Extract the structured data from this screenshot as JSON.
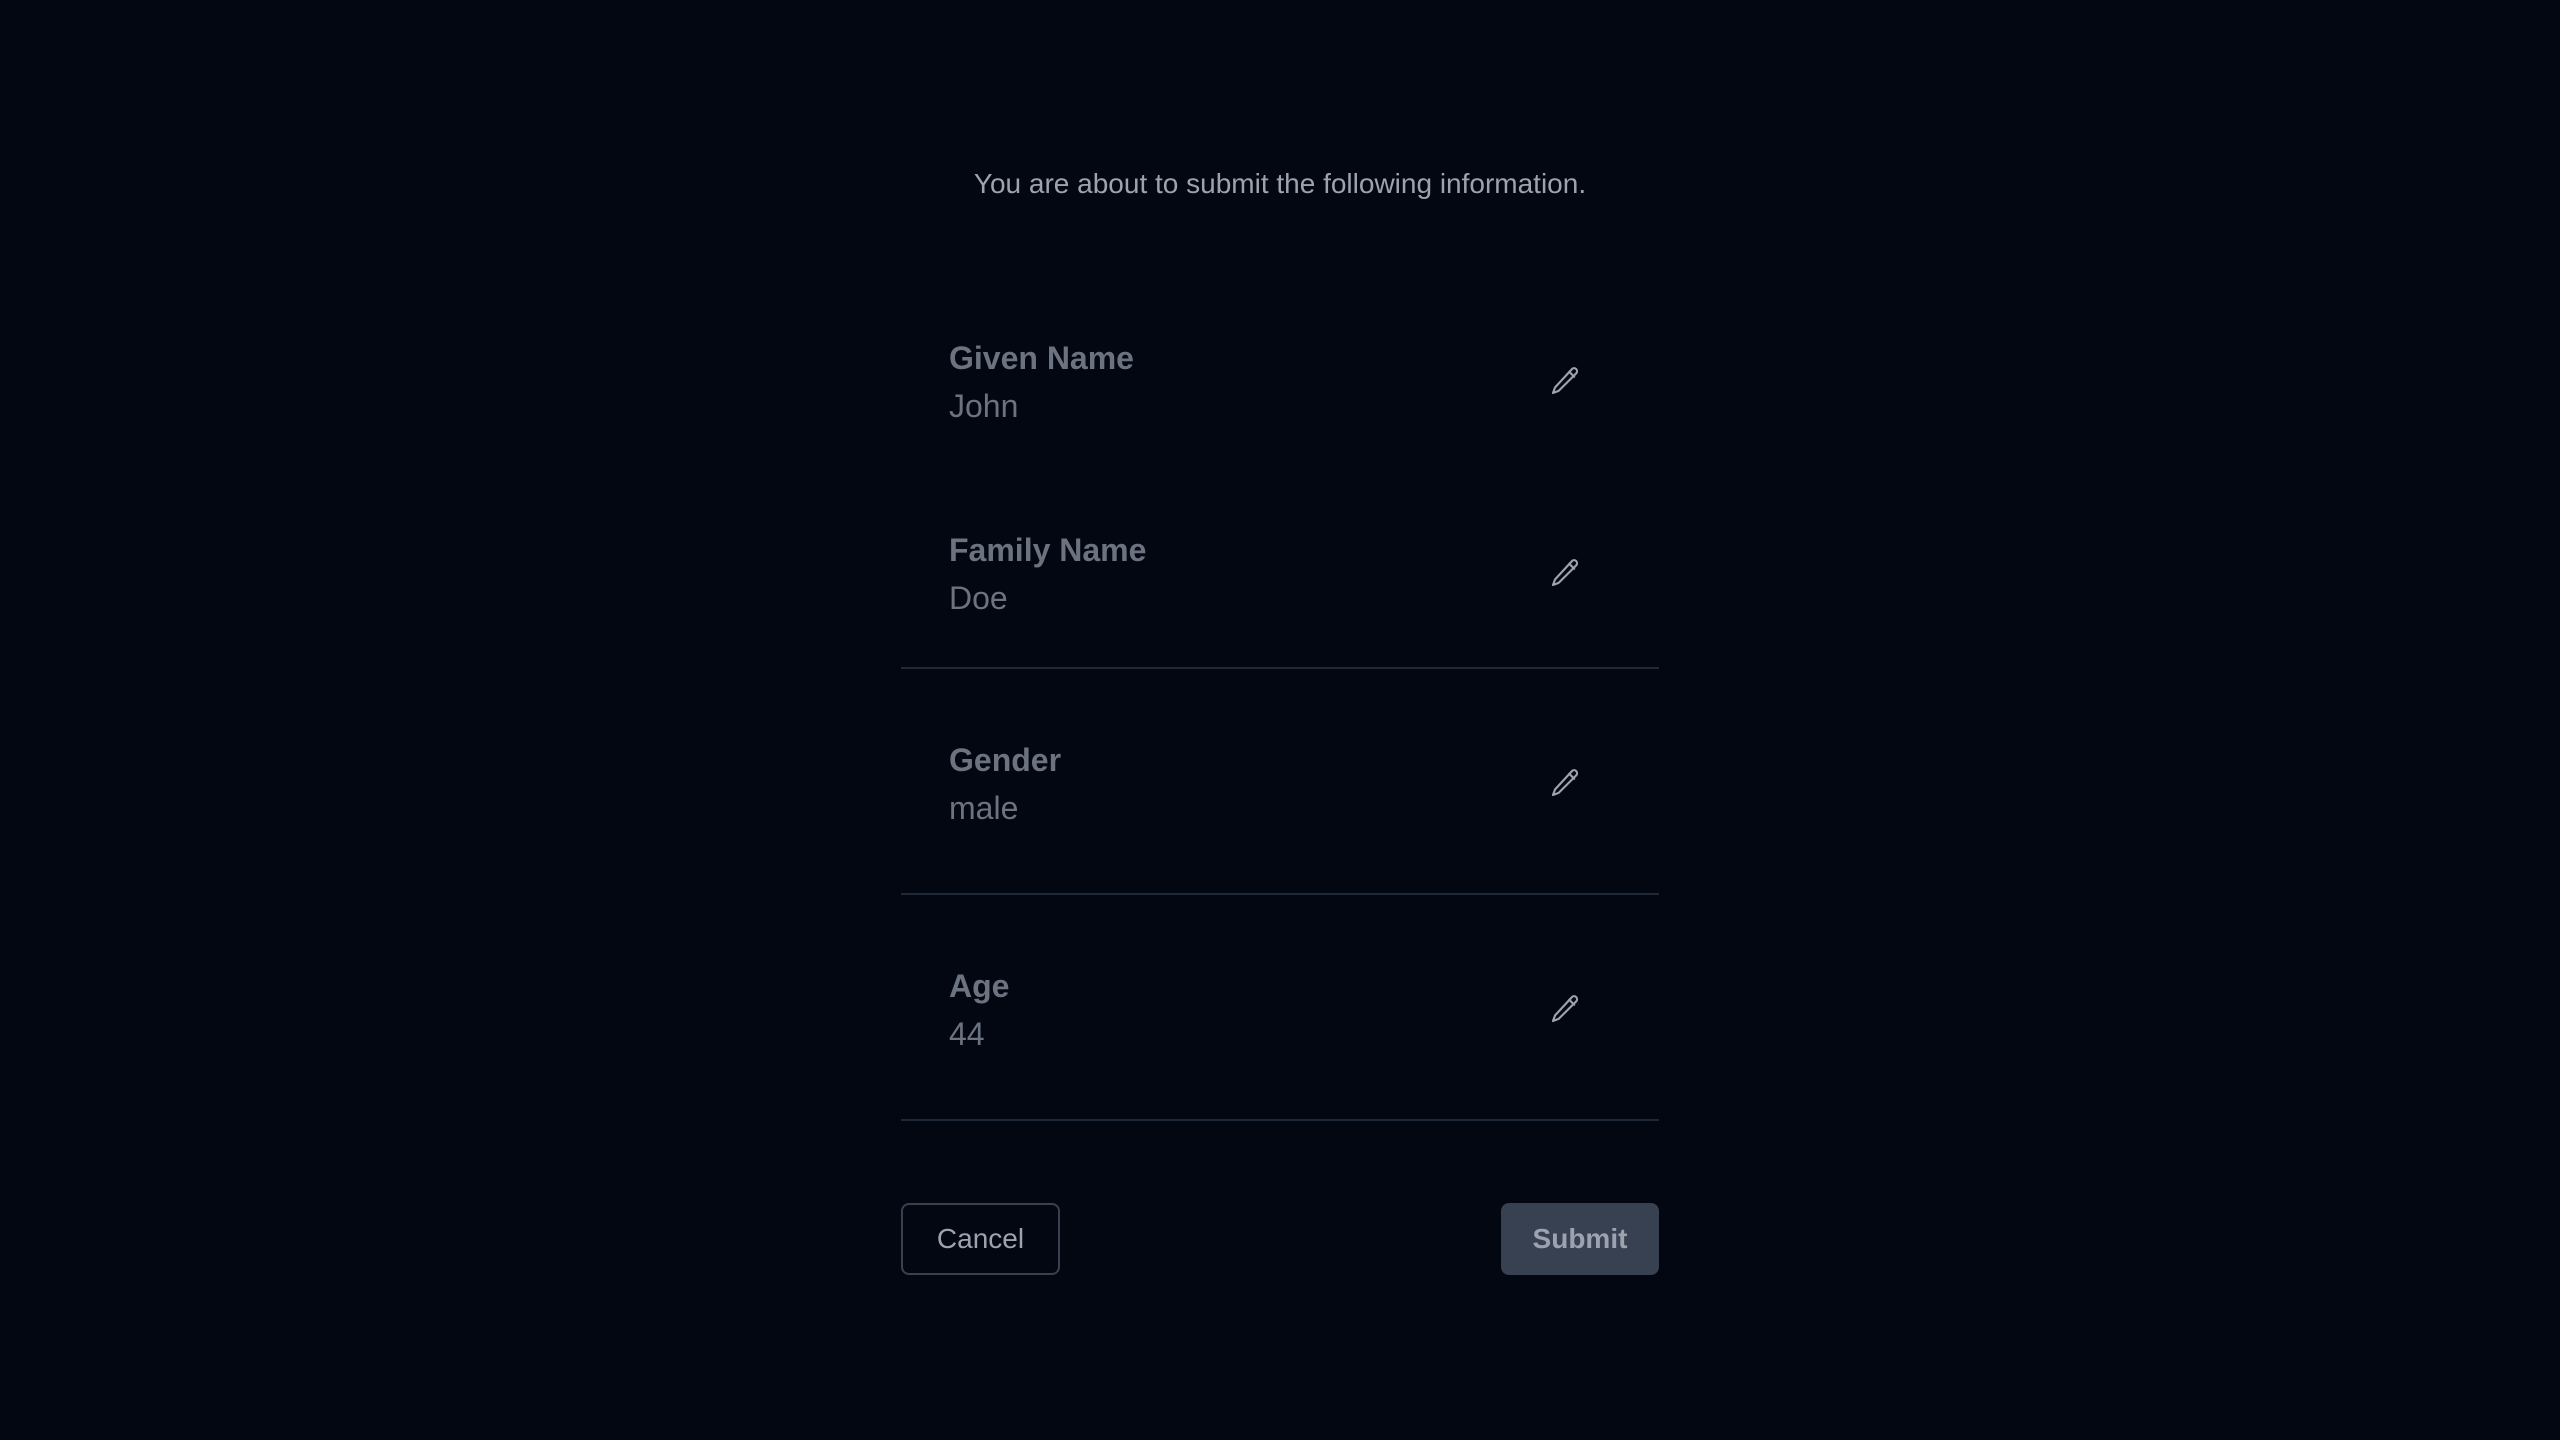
{
  "intro": "You are about to submit the following information.",
  "fields": [
    {
      "label": "Given Name",
      "value": "John",
      "edit_icon": "pencil-icon"
    },
    {
      "label": "Family Name",
      "value": "Doe",
      "edit_icon": "pencil-icon"
    },
    {
      "label": "Gender",
      "value": "male",
      "edit_icon": "pencil-icon"
    },
    {
      "label": "Age",
      "value": "44",
      "edit_icon": "pencil-icon"
    }
  ],
  "actions": {
    "cancel_label": "Cancel",
    "submit_label": "Submit"
  },
  "colors": {
    "background": "#030712",
    "text_muted": "#9ca3af",
    "label_text": "#6b7280",
    "divider": "#1f2937",
    "submit_bg": "#374151"
  }
}
